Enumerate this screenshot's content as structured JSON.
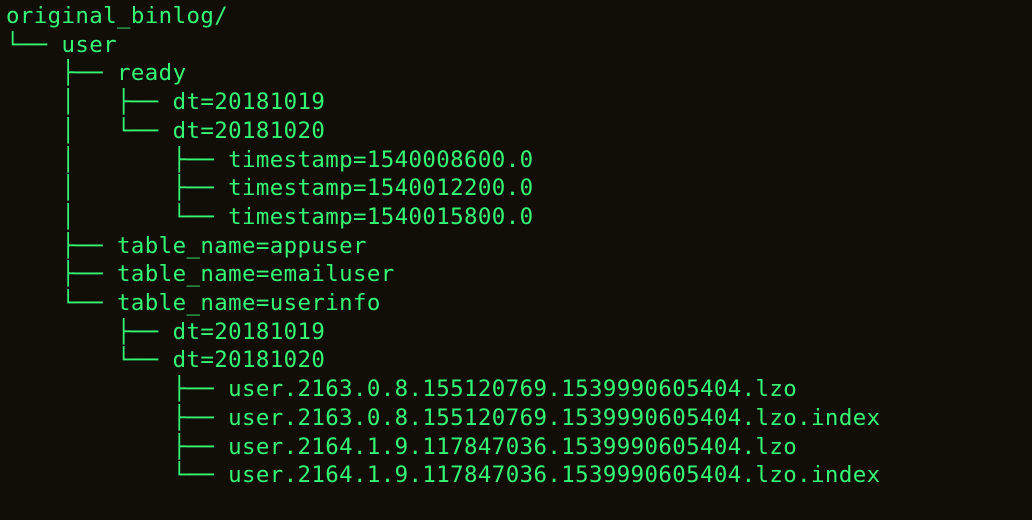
{
  "tree": {
    "lines": [
      "original_binlog/",
      "└── user",
      "    ├── ready",
      "    │   ├── dt=20181019",
      "    │   └── dt=20181020",
      "    │       ├── timestamp=1540008600.0",
      "    │       ├── timestamp=1540012200.0",
      "    │       └── timestamp=1540015800.0",
      "    ├── table_name=appuser",
      "    ├── table_name=emailuser",
      "    └── table_name=userinfo",
      "        ├── dt=20181019",
      "        └── dt=20181020",
      "            ├── user.2163.0.8.155120769.1539990605404.lzo",
      "            ├── user.2163.0.8.155120769.1539990605404.lzo.index",
      "            ├── user.2164.1.9.117847036.1539990605404.lzo",
      "            └── user.2164.1.9.117847036.1539990605404.lzo.index"
    ]
  }
}
